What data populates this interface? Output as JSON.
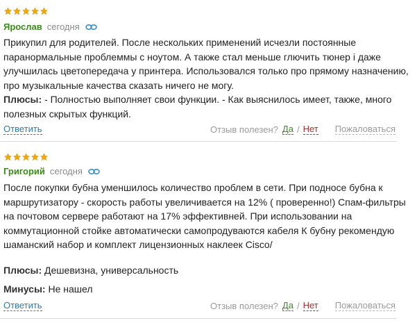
{
  "reviews": [
    {
      "rating": 5,
      "author": "Ярослав",
      "date": "сегодня",
      "body": "Прикупил для родителей. После нескольких применений исчезли постоянные паранормальные проблеммы с ноутом. А также стал меньше глючить тюнер і даже улучшилась цветопередача у принтера. Использовался только про прямому назначению, про музыкальные качества сказать ничего не могу.",
      "pros_label": "Плюсы:",
      "pros": " - Полностью выполняет свои функции. - Как выяснилось имеет, также, много полезных скрытых функций.",
      "reply": "Ответить",
      "helpful": "Отзыв полезен?",
      "yes": "Да",
      "no": "Нет",
      "complain": "Пожаловаться"
    },
    {
      "rating": 5,
      "author": "Григорий",
      "date": "сегодня",
      "body": "После покупки бубна уменшилось количество проблем в сети. При подносе бубна к маршрутизатору - скорость работы увеличивается на 12% ( проверенно!) Спам-фильтры на почтовом сервере работают на 17% эффективней. При использовании на коммутационной стойке автоматически самопродуваются кабеля К бубну рекомендую шаманский набор и комплект лицензионных наклеек Cisco/",
      "pros_label": "Плюсы:",
      "pros": " Дешевизна, универсальность",
      "cons_label": "Минусы:",
      "cons": " Не нашел",
      "reply": "Ответить",
      "helpful": "Отзыв полезен?",
      "yes": "Да",
      "no": "Нет",
      "complain": "Пожаловаться"
    }
  ],
  "icons": {
    "star": "star-icon",
    "link": "link-icon"
  },
  "colors": {
    "author": "#3a8a1a",
    "star": "#f0a800",
    "reply": "#2e7ab0",
    "yes": "#3a8a1a",
    "no": "#cc2222"
  }
}
